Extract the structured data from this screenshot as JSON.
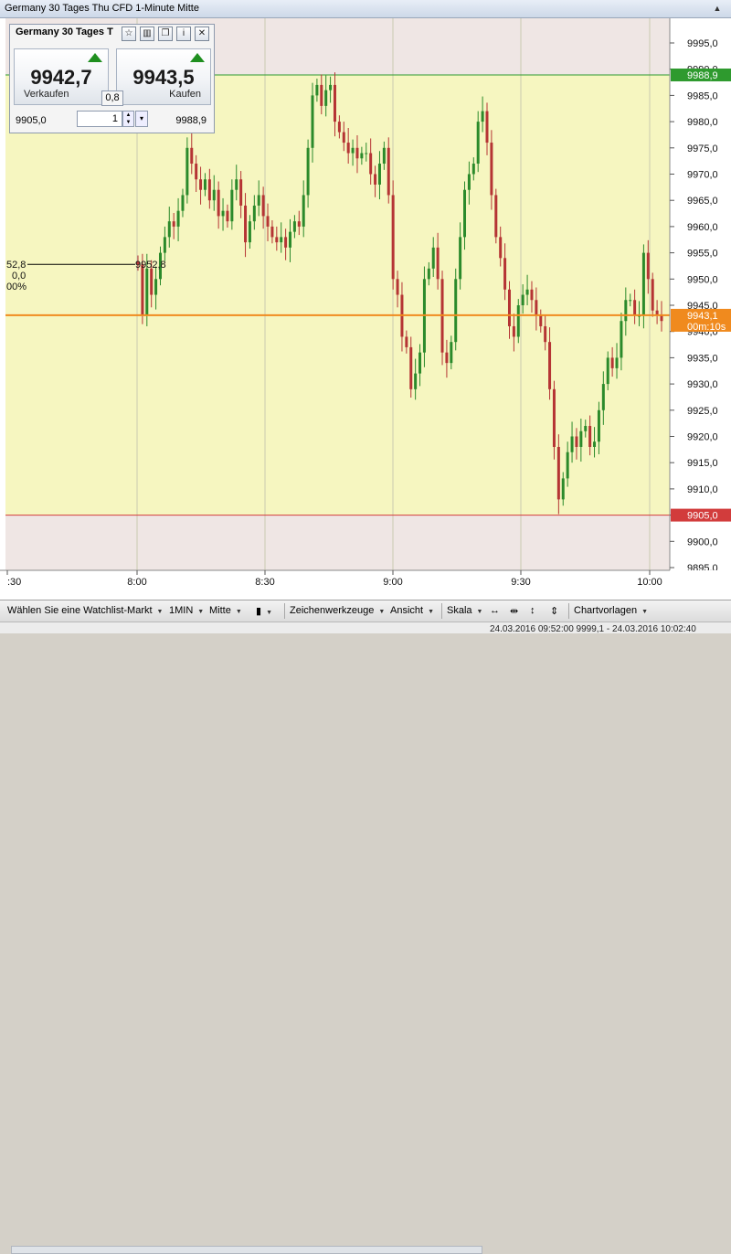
{
  "window": {
    "title": "Germany 30 Tages Thu CFD 1-Minute Mitte"
  },
  "order_panel": {
    "title": "Germany 30 Tages T",
    "sell": {
      "price": "9942,7",
      "label": "Verkaufen"
    },
    "buy": {
      "price": "9943,5",
      "label": "Kaufen"
    },
    "spread": "0,8",
    "low": "9905,0",
    "high": "9988,9",
    "quantity": "1"
  },
  "chart": {
    "y_axis": {
      "min": 9895,
      "max": 9995,
      "step": 5,
      "ticks": [
        "9995,0",
        "9990,0",
        "9985,0",
        "9980,0",
        "9975,0",
        "9970,0",
        "9965,0",
        "9960,0",
        "9955,0",
        "9950,0",
        "9945,0",
        "9940,0",
        "9935,0",
        "9930,0",
        "9925,0",
        "9920,0",
        "9915,0",
        "9910,0",
        "9905,0",
        "9900,0",
        "9895,0"
      ]
    },
    "x_axis": {
      "labels": [
        ":30",
        "8:00",
        "8:30",
        "9:00",
        "9:30",
        "10:00"
      ]
    },
    "high_line": {
      "value": 9988.9,
      "label": "9988,9",
      "color": "#2e9a2e"
    },
    "low_line": {
      "value": 9905.0,
      "label": "9905,0",
      "color": "#d23c3c"
    },
    "current": {
      "value": 9943.1,
      "label": "9943,1",
      "countdown": "00m:10s",
      "color": "#f08a1e"
    },
    "session_shade": {
      "color": "#f6f6c0"
    },
    "annotations": {
      "left_value": "52,8",
      "left_change": "0,0",
      "left_pct": "00%",
      "open_label": "9952,8"
    },
    "colors": {
      "up": "#2b8a2b",
      "down": "#b53434",
      "outside": "#efe6e4"
    }
  },
  "chart_data": {
    "type": "candlestick",
    "ylim": [
      9895,
      9995
    ],
    "x_labels": [
      ":30",
      "8:00",
      "8:30",
      "9:00",
      "9:30",
      "10:00"
    ],
    "series": [
      {
        "values": [
          9952.8,
          9943,
          9952,
          9947,
          9950,
          9955,
          9958,
          9961,
          9960,
          9963,
          9966,
          9975,
          9972,
          9969,
          9967,
          9969,
          9965,
          9967,
          9962,
          9963,
          9961,
          9967,
          9969,
          9964,
          9957,
          9961,
          9964,
          9966,
          9962,
          9960,
          9958,
          9957,
          9958,
          9956,
          9959,
          9961,
          9960,
          9966,
          9975,
          9985,
          9987,
          9983,
          9986,
          9987,
          9980,
          9978,
          9976,
          9974,
          9975,
          9973,
          9974,
          9974,
          9970,
          9968,
          9972,
          9975,
          9966,
          9950,
          9947,
          9939,
          9937,
          9929,
          9932,
          9936,
          9950,
          9952,
          9956,
          9950,
          9936,
          9934,
          9938,
          9950,
          9958,
          9967,
          9970,
          9972,
          9980,
          9982,
          9976,
          9966,
          9958,
          9954,
          9948,
          9941,
          9939,
          9945,
          9947,
          9948,
          9946,
          9943,
          9941,
          9938,
          9929,
          9918,
          9908,
          9912,
          9917,
          9920,
          9918,
          9921,
          9922,
          9918,
          9919,
          9925,
          9930,
          9935,
          9933,
          9935,
          9942,
          9946,
          9946,
          9943,
          9943,
          9955,
          9950,
          9944,
          9943,
          9942
        ]
      }
    ]
  },
  "toolbar": {
    "watchlist": "Wählen Sie eine Watchlist-Markt",
    "interval": "1MIN",
    "price_type": "Mitte",
    "drawing_tools": "Zeichenwerkzeuge",
    "view": "Ansicht",
    "scale": "Skala",
    "templates": "Chartvorlagen"
  },
  "status": {
    "text": "24.03.2016 09:52:00 9999,1 - 24.03.2016 10:02:40"
  }
}
